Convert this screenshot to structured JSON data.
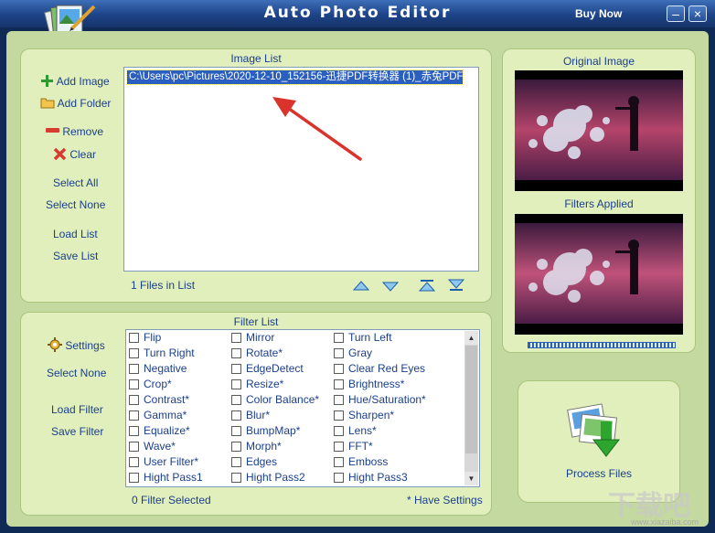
{
  "window": {
    "title": "Auto Photo Editor",
    "buy_now": "Buy Now",
    "min": "–",
    "close": "×"
  },
  "image_list": {
    "title": "Image List",
    "selected_item": "C:\\Users\\pc\\Pictures\\2020-12-10_152156-迅捷PDF转换器 (1)_赤兔PDF...",
    "status": "1 Files in List",
    "buttons": {
      "add_image": "Add Image",
      "add_folder": "Add Folder",
      "remove": "Remove",
      "clear": "Clear",
      "select_all": "Select All",
      "select_none": "Select None",
      "load_list": "Load List",
      "save_list": "Save List"
    }
  },
  "filter_list": {
    "title": "Filter List",
    "status": "0 Filter Selected",
    "note": "* Have Settings",
    "buttons": {
      "settings": "Settings",
      "select_none": "Select None",
      "load_filter": "Load Filter",
      "save_filter": "Save Filter"
    },
    "col1": [
      "Flip",
      "Turn Right",
      "Negative",
      "Crop*",
      "Contrast*",
      "Gamma*",
      "Equalize*",
      "Wave*",
      "User Filter*",
      "Hight Pass1"
    ],
    "col2": [
      "Mirror",
      "Rotate*",
      "EdgeDetect",
      "Resize*",
      "Color Balance*",
      "Blur*",
      "BumpMap*",
      "Morph*",
      "Edges",
      "Hight Pass2"
    ],
    "col3": [
      "Turn Left",
      "Gray",
      "Clear Red Eyes",
      "Brightness*",
      "Hue/Saturation*",
      "Sharpen*",
      "Lens*",
      "FFT*",
      "Emboss",
      "Hight Pass3"
    ]
  },
  "preview": {
    "original_label": "Original Image",
    "filtered_label": "Filters Applied"
  },
  "process": {
    "label": "Process Files"
  },
  "watermark": {
    "text": "下载吧",
    "url": "www.xiazaiba.com"
  },
  "colors": {
    "panel": "#e1efbd",
    "background": "#c3d99f",
    "text": "#1a3f8c",
    "selection": "#2a5fc0",
    "arrow": "#d9332b"
  }
}
